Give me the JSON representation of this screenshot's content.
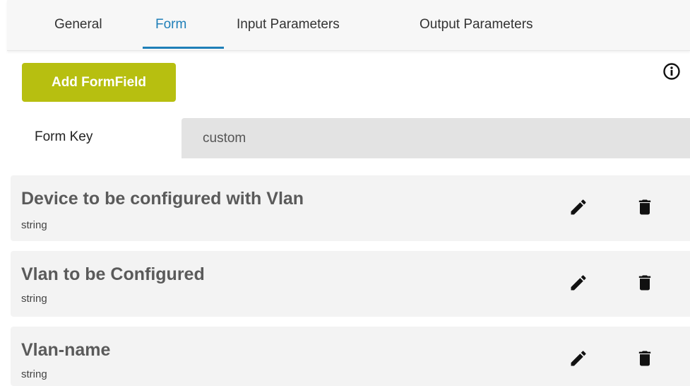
{
  "tabs": [
    {
      "label": "General",
      "active": false
    },
    {
      "label": "Form",
      "active": true
    },
    {
      "label": "Input Parameters",
      "active": false
    },
    {
      "label": "Output Parameters",
      "active": false
    }
  ],
  "toolbar": {
    "add_label": "Add FormField",
    "info_icon": "info-circle-icon"
  },
  "form_key": {
    "label": "Form Key",
    "value": "custom"
  },
  "fields": [
    {
      "title": "Device to be configured with Vlan",
      "type": "string",
      "edit_icon": "pencil-icon",
      "delete_icon": "trash-icon"
    },
    {
      "title": "Vlan to be Configured",
      "type": "string",
      "edit_icon": "pencil-icon",
      "delete_icon": "trash-icon"
    },
    {
      "title": "Vlan-name",
      "type": "string",
      "edit_icon": "pencil-icon",
      "delete_icon": "trash-icon"
    }
  ],
  "colors": {
    "accent": "#1f7fb8",
    "add_button": "#b7bf10",
    "card_bg": "#f3f3f3",
    "input_bg": "#e3e3e3"
  }
}
